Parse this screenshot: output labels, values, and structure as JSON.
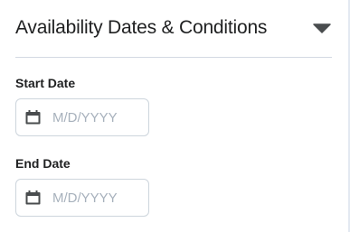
{
  "section": {
    "title": "Availability Dates & Conditions",
    "toggle_icon": "caret-down-icon"
  },
  "start_date": {
    "label": "Start Date",
    "placeholder": "M/D/YYYY",
    "value": "",
    "icon": "calendar-icon"
  },
  "end_date": {
    "label": "End Date",
    "placeholder": "M/D/YYYY",
    "value": "",
    "icon": "calendar-icon"
  },
  "colors": {
    "text": "#202122",
    "border": "#cdd5dc",
    "placeholder": "#a7b1bc",
    "divider": "#d3d9e3",
    "icon": "#494c4e"
  }
}
